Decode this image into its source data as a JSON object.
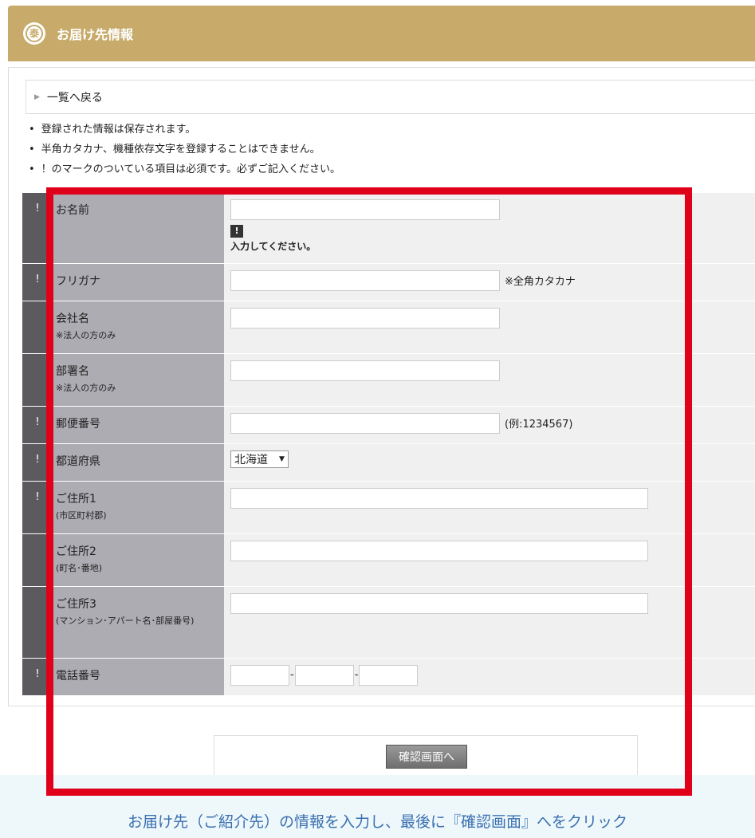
{
  "header": {
    "logo_char": "泰",
    "title": "お届け先情報"
  },
  "back_link": {
    "label": "一覧へ戻る"
  },
  "notes": [
    "登録された情報は保存されます。",
    "半角カタカナ、機種依存文字を登録することはできません。",
    "！のマークのついている項目は必須です。必ずご記入ください。"
  ],
  "form": {
    "required_mark": "!",
    "name": {
      "label": "お名前",
      "value": "",
      "error_icon": "!",
      "error": "入力してください。"
    },
    "kana": {
      "label": "フリガナ",
      "value": "",
      "hint": "※全角カタカナ"
    },
    "company": {
      "label": "会社名",
      "sub": "※法人の方のみ",
      "value": ""
    },
    "department": {
      "label": "部署名",
      "sub": "※法人の方のみ",
      "value": ""
    },
    "postal": {
      "label": "郵便番号",
      "value": "",
      "hint": "(例:1234567)"
    },
    "prefecture": {
      "label": "都道府県",
      "selected": "北海道"
    },
    "address1": {
      "label": "ご住所1",
      "sub": "(市区町村郡)",
      "value": ""
    },
    "address2": {
      "label": "ご住所2",
      "sub": "(町名･番地)",
      "value": ""
    },
    "address3": {
      "label": "ご住所3",
      "sub": "(マンション･アパート名･部屋番号)",
      "value": ""
    },
    "phone": {
      "label": "電話番号",
      "separator": "-",
      "part1": "",
      "part2": "",
      "part3": ""
    }
  },
  "submit": {
    "label": "確認画面へ"
  },
  "caption": "お届け先（ご紹介先）の情報を入力し、最後に『確認画面』へをクリック",
  "colors": {
    "header": "#c8ab6b",
    "highlight": "#e0001a",
    "caption": "#3a6fb0"
  }
}
